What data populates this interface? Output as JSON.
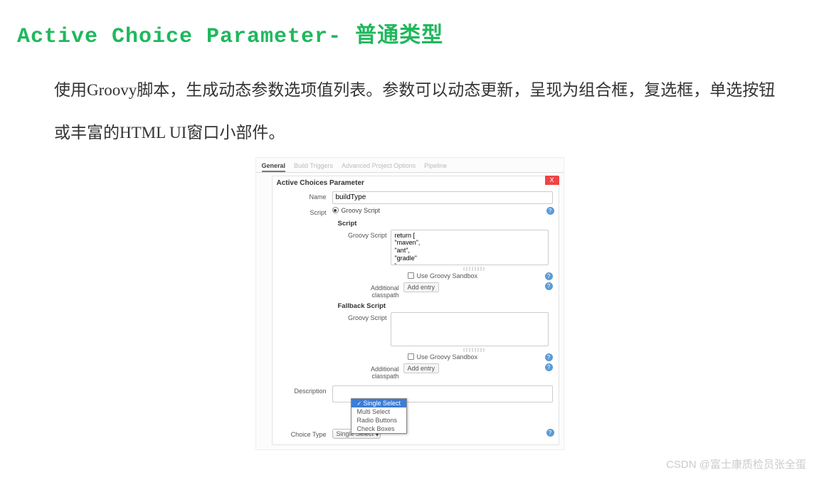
{
  "heading": "Active Choice Parameter- 普通类型",
  "paragraph": "使用Groovy脚本，生成动态参数选项值列表。参数可以动态更新，呈现为组合框，复选框，单选按钮或丰富的HTML UI窗口小部件。",
  "tabs": {
    "general": "General",
    "build_triggers": "Build Triggers",
    "adv_options": "Advanced Project Options",
    "pipeline": "Pipeline"
  },
  "panel": {
    "title": "Active Choices Parameter",
    "close": "X",
    "name_label": "Name",
    "name_value": "buildType",
    "script_label": "Script",
    "radio_groovy": "Groovy Script",
    "script_section": "Script",
    "groovy_script_label": "Groovy Script",
    "groovy_script_value": "return [\n\"maven\",\n\"ant\",\n\"gradle\"\n]",
    "use_sandbox": "Use Groovy Sandbox",
    "addl_classpath": "Additional classpath",
    "add_entry": "Add entry",
    "fallback_section": "Fallback Script",
    "fallback_value": "",
    "description_label": "Description",
    "description_value": "",
    "choice_type_label": "Choice Type",
    "choice_type_value": "Single Select",
    "dropdown_options": [
      "Single Select",
      "Multi Select",
      "Radio Buttons",
      "Check Boxes"
    ],
    "help": "?"
  },
  "watermark": "CSDN @富士康质检员张全蛋"
}
